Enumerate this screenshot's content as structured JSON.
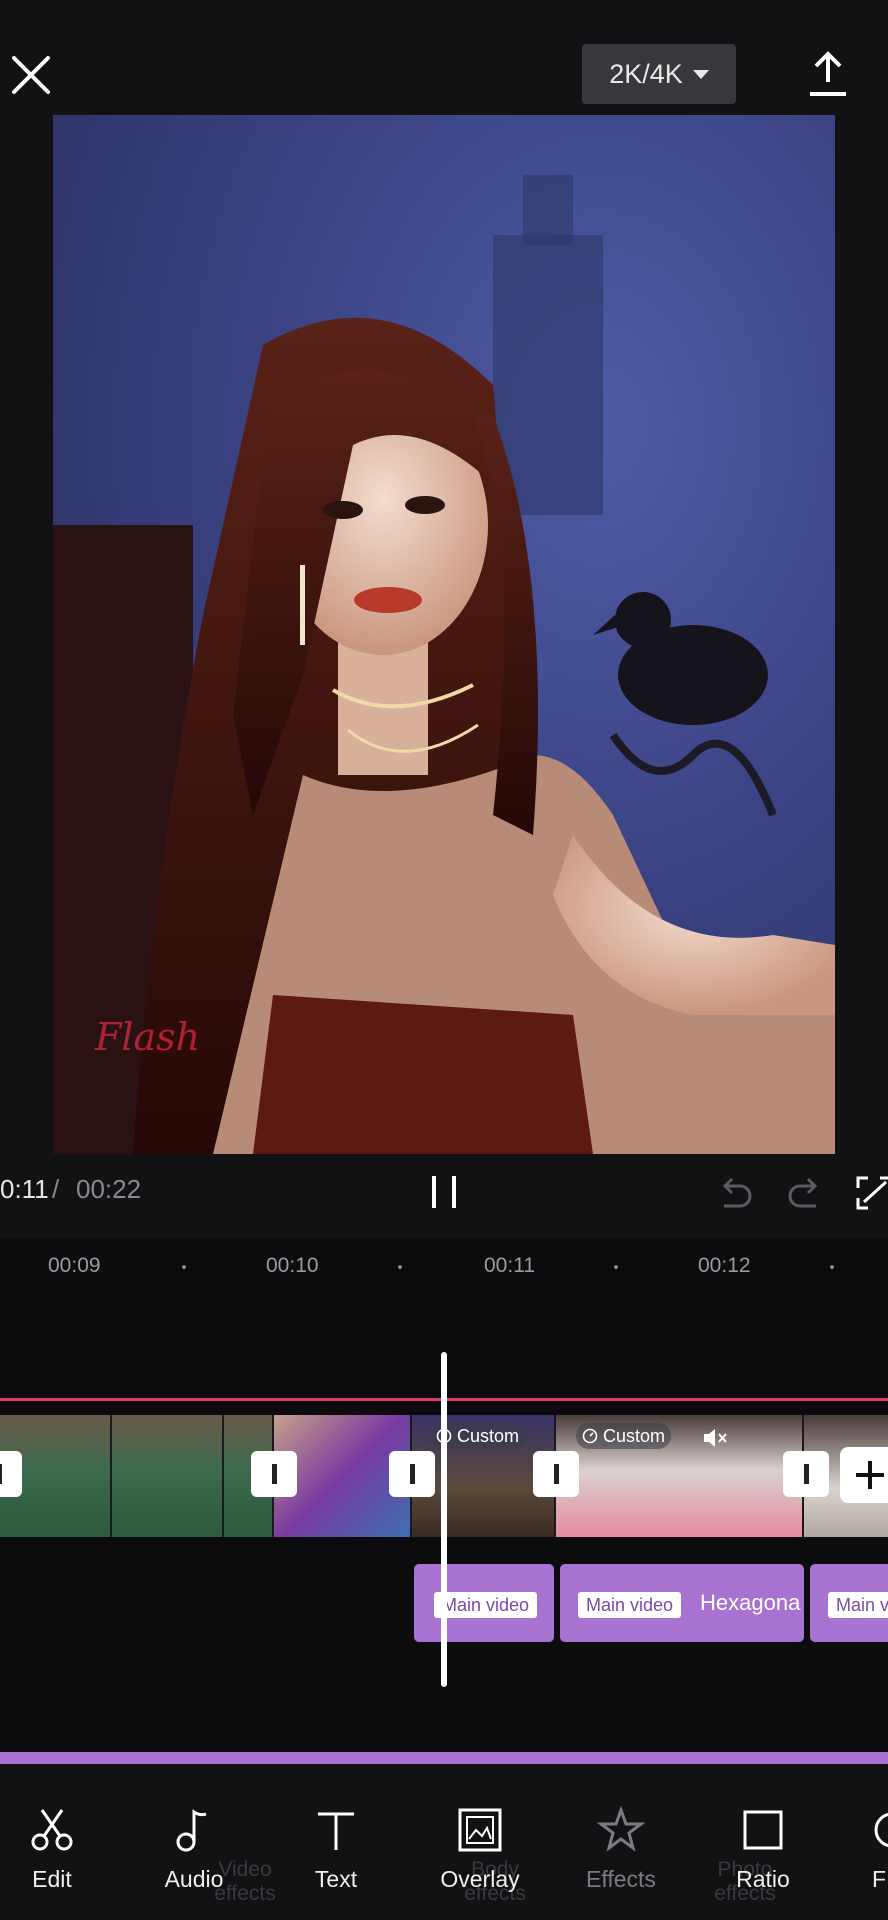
{
  "header": {
    "quality_label": "2K/4K"
  },
  "player": {
    "current_time": "0:11",
    "separator": "/",
    "total_time": "00:22"
  },
  "preview": {
    "watermark": "Flash"
  },
  "ruler": {
    "labels": [
      "00:09",
      "00:10",
      "00:11",
      "00:12"
    ]
  },
  "main_track": {
    "tags": [
      {
        "label": "Custom",
        "icon": "speed-icon"
      },
      {
        "label": "Custom",
        "icon": "speed-icon"
      }
    ]
  },
  "overlay_track": {
    "clips": [
      {
        "label": "Main video",
        "text": ""
      },
      {
        "label": "Main video",
        "text": "Hexagona"
      },
      {
        "label": "Main v",
        "text": ""
      }
    ]
  },
  "toolbar": {
    "items": [
      {
        "label": "Edit",
        "icon": "scissors-icon",
        "active": true
      },
      {
        "label": "Audio",
        "icon": "music-note-icon",
        "active": true
      },
      {
        "label": "Text",
        "icon": "text-icon",
        "active": true
      },
      {
        "label": "Overlay",
        "icon": "overlay-icon",
        "active": true
      },
      {
        "label": "Effects",
        "icon": "star-icon",
        "active": false
      },
      {
        "label": "Ratio",
        "icon": "ratio-icon",
        "active": true
      },
      {
        "label": "F",
        "icon": "filter-icon",
        "active": true
      }
    ],
    "ghost_labels": [
      "Video effects",
      "Body effects",
      "Photo effects"
    ]
  },
  "colors": {
    "accent_red": "#e03a63",
    "overlay_purple": "#a873d0",
    "background": "#121214"
  }
}
